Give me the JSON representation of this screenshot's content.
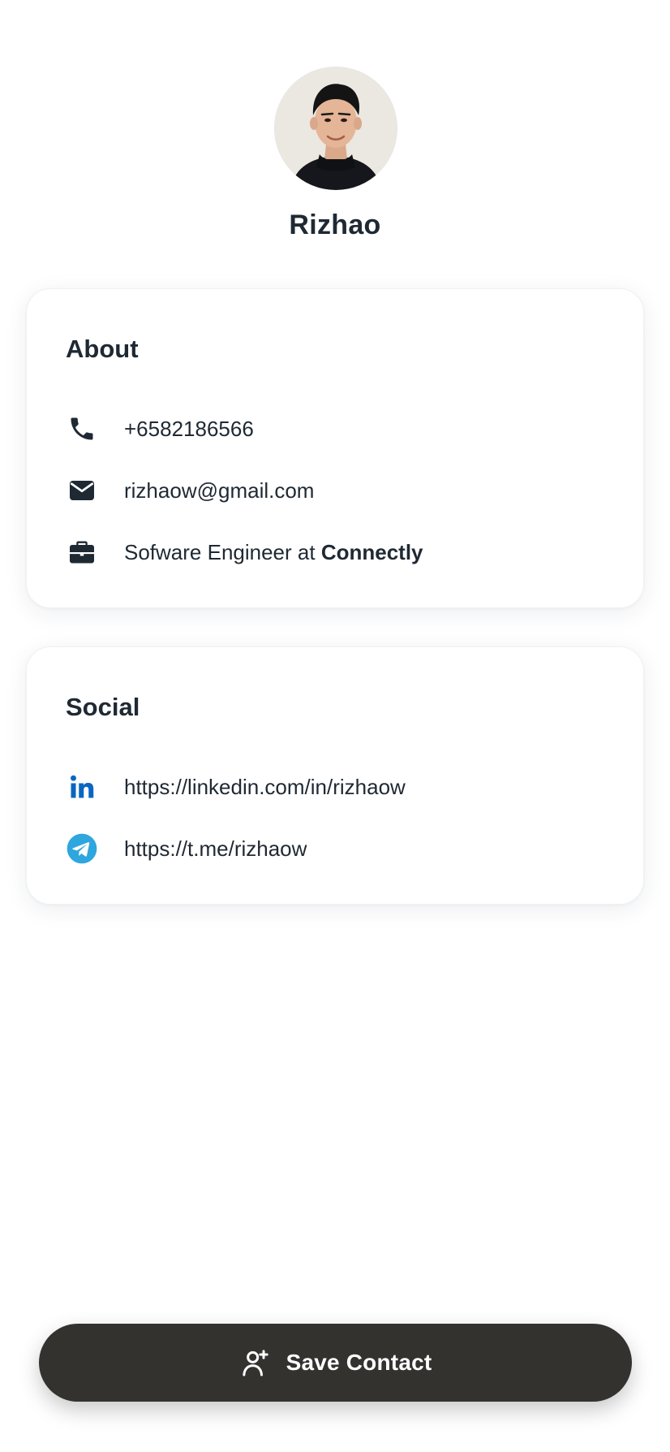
{
  "profile": {
    "name": "Rizhao"
  },
  "about": {
    "title": "About",
    "phone": "+6582186566",
    "email": "rizhaow@gmail.com",
    "job_prefix": "Sofware Engineer at ",
    "company": "Connectly"
  },
  "social": {
    "title": "Social",
    "linkedin": "https://linkedin.com/in/rizhaow",
    "telegram": "https://t.me/rizhaow"
  },
  "actions": {
    "save_label": "Save Contact"
  },
  "icons": {
    "phone": "phone-icon",
    "email": "envelope-icon",
    "job": "briefcase-icon",
    "linkedin": "linkedin-icon",
    "telegram": "telegram-icon",
    "save": "add-person-icon"
  },
  "colors": {
    "text": "#1f2933",
    "button": "#33322f",
    "linkedin": "#0a66c2",
    "telegram": "#2ea6de"
  }
}
